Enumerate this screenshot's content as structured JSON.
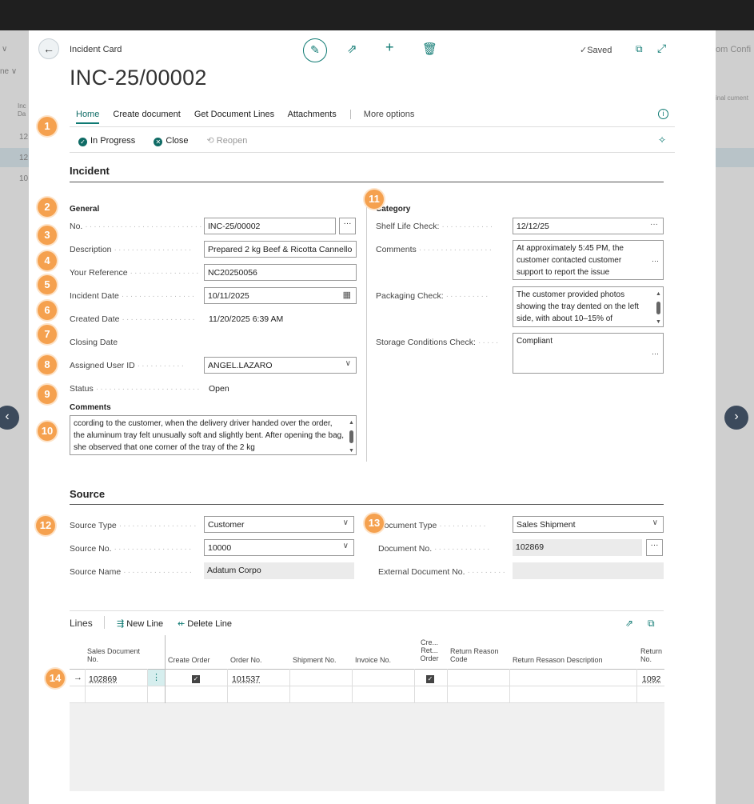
{
  "header": {
    "breadcrumb": "Incident Card",
    "title": "INC-25/00002",
    "saved": "Saved"
  },
  "tabs": [
    "Home",
    "Create document",
    "Get Document Lines",
    "Attachments",
    "More options"
  ],
  "actions": {
    "in_progress": "In Progress",
    "close": "Close",
    "reopen": "Reopen"
  },
  "incident": {
    "section_title": "Incident",
    "general_title": "General",
    "fields": {
      "no": {
        "label": "No.",
        "value": "INC-25/00002"
      },
      "description": {
        "label": "Description",
        "value": "Prepared 2 kg Beef & Ricotta Cannello"
      },
      "your_reference": {
        "label": "Your Reference",
        "value": "NC20250056"
      },
      "incident_date": {
        "label": "Incident Date",
        "value": "10/11/2025"
      },
      "created_date": {
        "label": "Created Date",
        "value": "11/20/2025 6:39 AM"
      },
      "closing_date": {
        "label": "Closing Date",
        "value": ""
      },
      "assigned_user": {
        "label": "Assigned User ID",
        "value": "ANGEL.LAZARO"
      },
      "status": {
        "label": "Status",
        "value": "Open"
      }
    },
    "comments_title": "Comments",
    "comments_text": "ccording to the customer, when the delivery driver handed over the order, the aluminum tray felt unusually soft and slightly bent. After opening the bag, she observed that one corner of the tray of  the 2 kg",
    "category": {
      "title": "Category",
      "shelf_life": {
        "label": "Shelf Life Check:",
        "value": "12/12/25"
      },
      "comments": {
        "label": "Comments",
        "value": "At approximately 5:45 PM, the customer contacted customer support to report the issue"
      },
      "packaging": {
        "label": "Packaging Check:",
        "value": "The customer provided photos showing the tray dented on the left side, with about 10–15% of"
      },
      "storage": {
        "label": "Storage Conditions Check:",
        "value": "Compliant"
      }
    }
  },
  "source": {
    "section_title": "Source",
    "source_type": {
      "label": "Source Type",
      "value": "Customer"
    },
    "source_no": {
      "label": "Source No.",
      "value": "10000"
    },
    "source_name": {
      "label": "Source Name",
      "value": "Adatum Corpo"
    },
    "document_type": {
      "label": "Document Type",
      "value": "Sales Shipment"
    },
    "document_no": {
      "label": "Document No.",
      "value": "102869"
    },
    "external_doc_no": {
      "label": "External Document No.",
      "value": ""
    }
  },
  "lines": {
    "title": "Lines",
    "new_line": "New Line",
    "delete_line": "Delete Line",
    "columns": [
      "Sales Document No.",
      "Create Order",
      "Order No.",
      "Shipment No.",
      "Invoice No.",
      "Cre... Ret... Order",
      "Return Reason Code",
      "Return Resason Description",
      "Return No."
    ],
    "row": {
      "sales_doc": "102869",
      "order_no": "101537",
      "return_no": "1092"
    }
  },
  "badges": [
    "1",
    "2",
    "3",
    "4",
    "5",
    "6",
    "7",
    "8",
    "9",
    "10",
    "11",
    "12",
    "13",
    "14"
  ],
  "background": {
    "right_text": "om Confi",
    "right_col": "inal cument",
    "left_rows": [
      "12",
      "12",
      "10"
    ]
  }
}
